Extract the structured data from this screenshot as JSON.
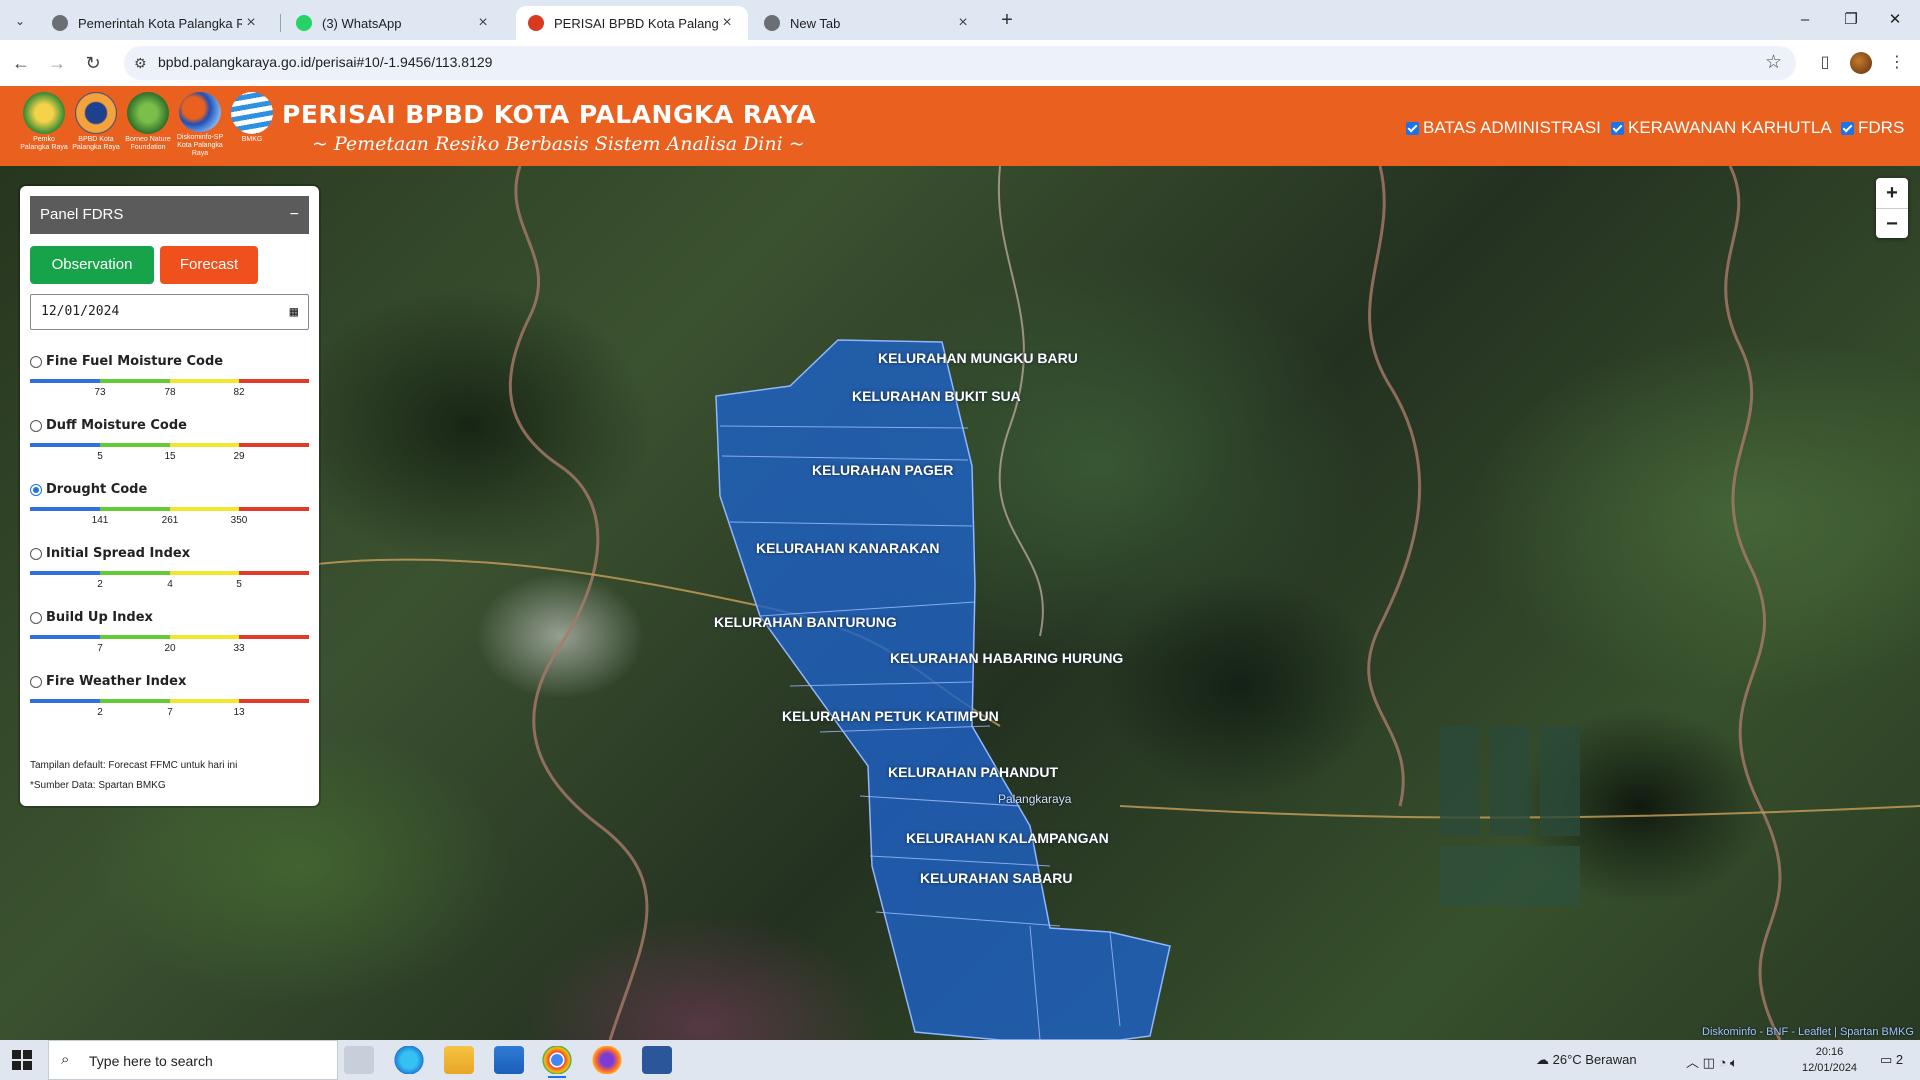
{
  "browser": {
    "tabs": [
      {
        "title": "Pemerintah Kota Palangka Raya",
        "active": false
      },
      {
        "title": "(3) WhatsApp",
        "active": false
      },
      {
        "title": "PERISAI BPBD Kota Palangka Raya",
        "active": true
      },
      {
        "title": "New Tab",
        "active": false
      }
    ],
    "url": "bpbd.palangkaraya.go.id/perisai#10/-1.9456/113.8129",
    "window_controls": [
      "–",
      "❐",
      "✕"
    ]
  },
  "header": {
    "logos": [
      {
        "caption": "Pemko Palangka Raya",
        "color": "#e8c12a"
      },
      {
        "caption": "BPBD Kota Palangka Raya",
        "color": "#f08a24"
      },
      {
        "caption": "Borneo Nature Foundation",
        "color": "#3f8f3a"
      },
      {
        "caption": "Diskominfo-SP Kota Palangka Raya",
        "color": "#2a6fd6"
      },
      {
        "caption": "BMKG",
        "color": "#3aa0de"
      }
    ],
    "title": "PERISAI BPBD KOTA PALANGKA RAYA",
    "subtitle": "~ Pemetaan Resiko Berbasis Sistem Analisa Dini ~",
    "layers": [
      {
        "label": "BATAS ADMINISTRASI",
        "checked": true
      },
      {
        "label": "KERAWANAN KARHUTLA",
        "checked": true
      },
      {
        "label": "FDRS",
        "checked": true
      }
    ]
  },
  "panel": {
    "title": "Panel FDRS",
    "minimize": "−",
    "observation_label": "Observation",
    "forecast_label": "Forecast",
    "date_value": "12/01/2024",
    "indices": [
      {
        "label": "Fine Fuel Moisture Code",
        "selected": false,
        "ticks": [
          "73",
          "78",
          "82"
        ]
      },
      {
        "label": "Duff Moisture Code",
        "selected": false,
        "ticks": [
          "5",
          "15",
          "29"
        ]
      },
      {
        "label": "Drought Code",
        "selected": true,
        "ticks": [
          "141",
          "261",
          "350"
        ]
      },
      {
        "label": "Initial Spread Index",
        "selected": false,
        "ticks": [
          "2",
          "4",
          "5"
        ]
      },
      {
        "label": "Build Up Index",
        "selected": false,
        "ticks": [
          "7",
          "20",
          "33"
        ]
      },
      {
        "label": "Fire Weather Index",
        "selected": false,
        "ticks": [
          "2",
          "7",
          "13"
        ]
      }
    ],
    "scale_colors": [
      "#2f6fe0",
      "#63cc35",
      "#f2e62c",
      "#e03a2a"
    ],
    "note1": "Tampilan default: Forecast FFMC untuk hari ini",
    "note2": "*Sumber Data: Spartan BMKG"
  },
  "map": {
    "kelurahan": [
      "KELURAHAN MUNGKU BARU",
      "KELURAHAN BUKIT SUA",
      "KELURAHAN PAGER",
      "KELURAHAN KANARAKAN",
      "KELURAHAN BANTURUNG",
      "KELURAHAN HABARING HURUNG",
      "KELURAHAN PETUK KATIMPUN",
      "KELURAHAN PAHANDUT",
      "KELURAHAN KALAMPANGAN",
      "KELURAHAN SABARU"
    ],
    "city_label": "Palangkaraya",
    "zoom_in": "+",
    "zoom_out": "−",
    "attribution": "Diskominfo - BNF - Leaflet | Spartan BMKG",
    "region_color": "#1f62c4"
  },
  "taskbar": {
    "search_placeholder": "Type here to search",
    "weather": "26°C  Berawan",
    "time": "20:16",
    "date": "12/01/2024",
    "notifications": "2"
  }
}
